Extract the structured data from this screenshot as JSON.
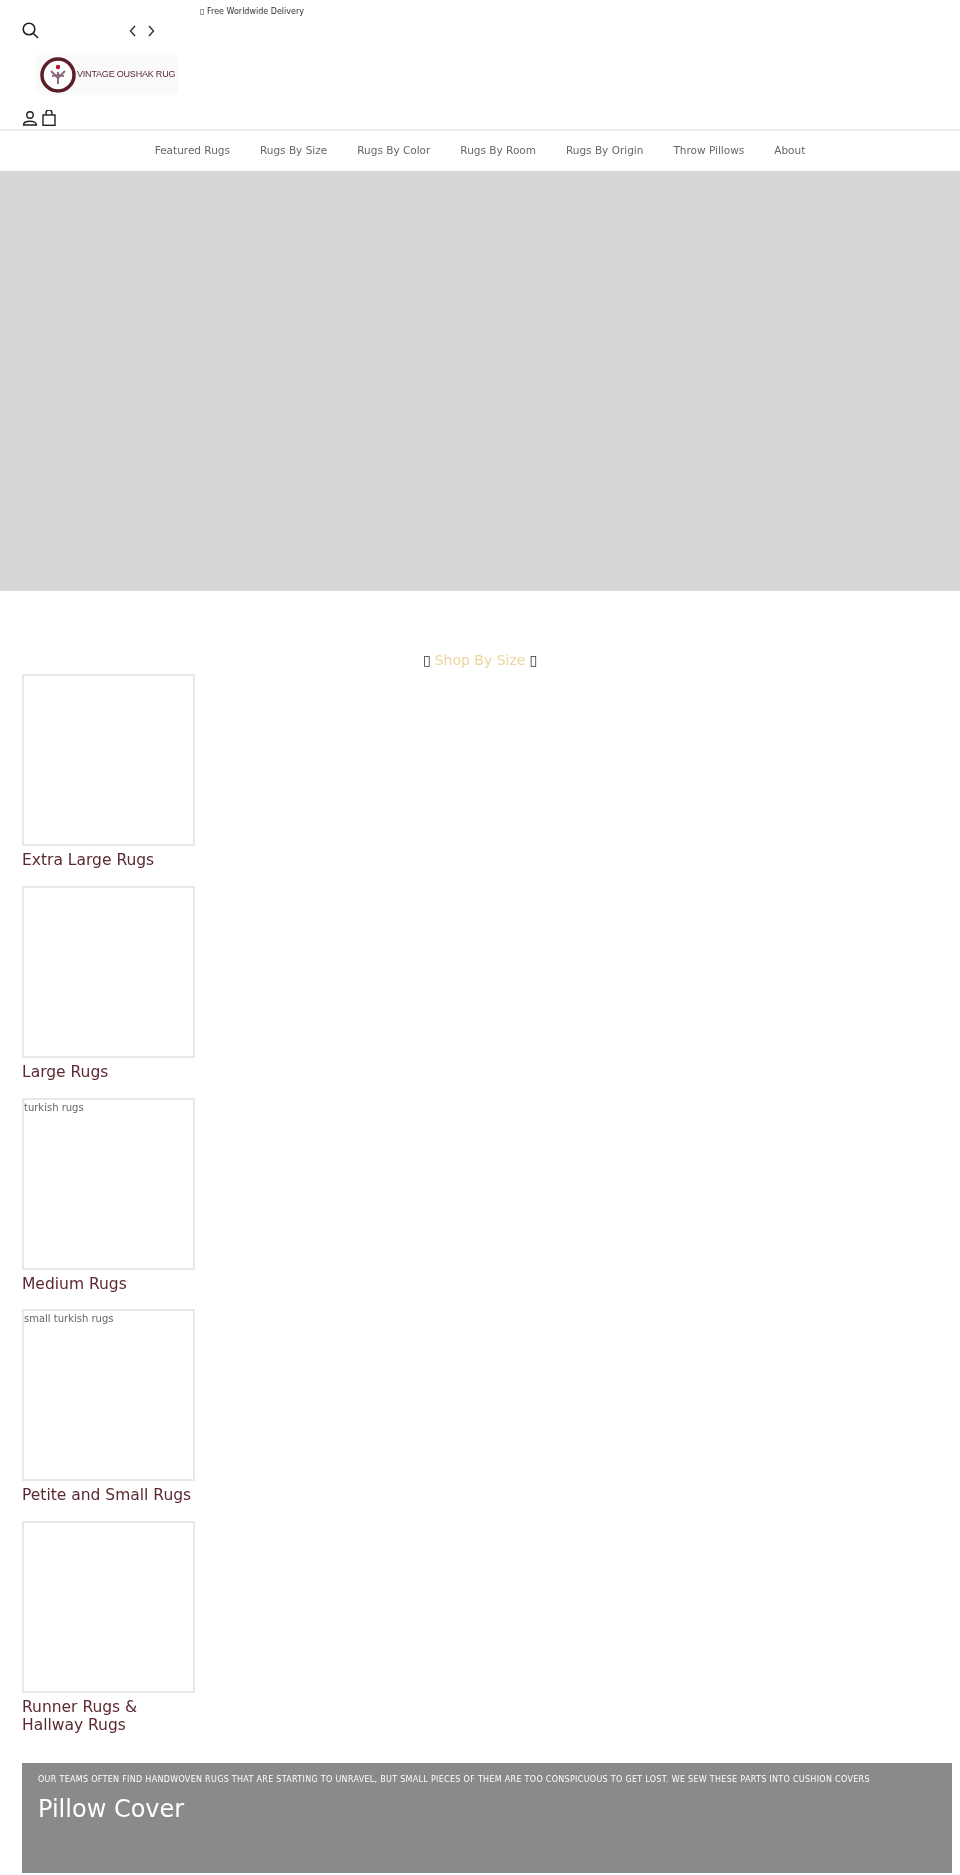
{
  "announcement": {
    "text": "▯ Free Worldwide Delivery"
  },
  "logo": {
    "text": "VINTAGE OUSHAK RUG"
  },
  "nav": [
    {
      "label": "Featured Rugs"
    },
    {
      "label": "Rugs By Size"
    },
    {
      "label": "Rugs By Color"
    },
    {
      "label": "Rugs By Room"
    },
    {
      "label": "Rugs By Origin"
    },
    {
      "label": "Throw Pillows"
    },
    {
      "label": "About"
    }
  ],
  "section": {
    "prefix": "▯",
    "title": "Shop By Size",
    "suffix": "▯"
  },
  "collections": [
    {
      "title": "Extra Large Rugs"
    },
    {
      "title": "Large Rugs"
    },
    {
      "title": "Medium Rugs",
      "alt_text": "turkish rugs"
    },
    {
      "title": "Petite and Small Rugs",
      "alt_text": "small turkish rugs"
    },
    {
      "title": "Runner Rugs & Hallway Rugs"
    }
  ],
  "banner": {
    "subtitle": "OUR TEAMS OFTEN FIND HANDWOVEN RUGS THAT ARE STARTING TO UNRAVEL, BUT SMALL PIECES OF THEM ARE TOO CONSPICUOUS TO GET LOST. WE SEW THESE PARTS INTO CUSHION COVERS",
    "title": "Pillow Cover"
  }
}
